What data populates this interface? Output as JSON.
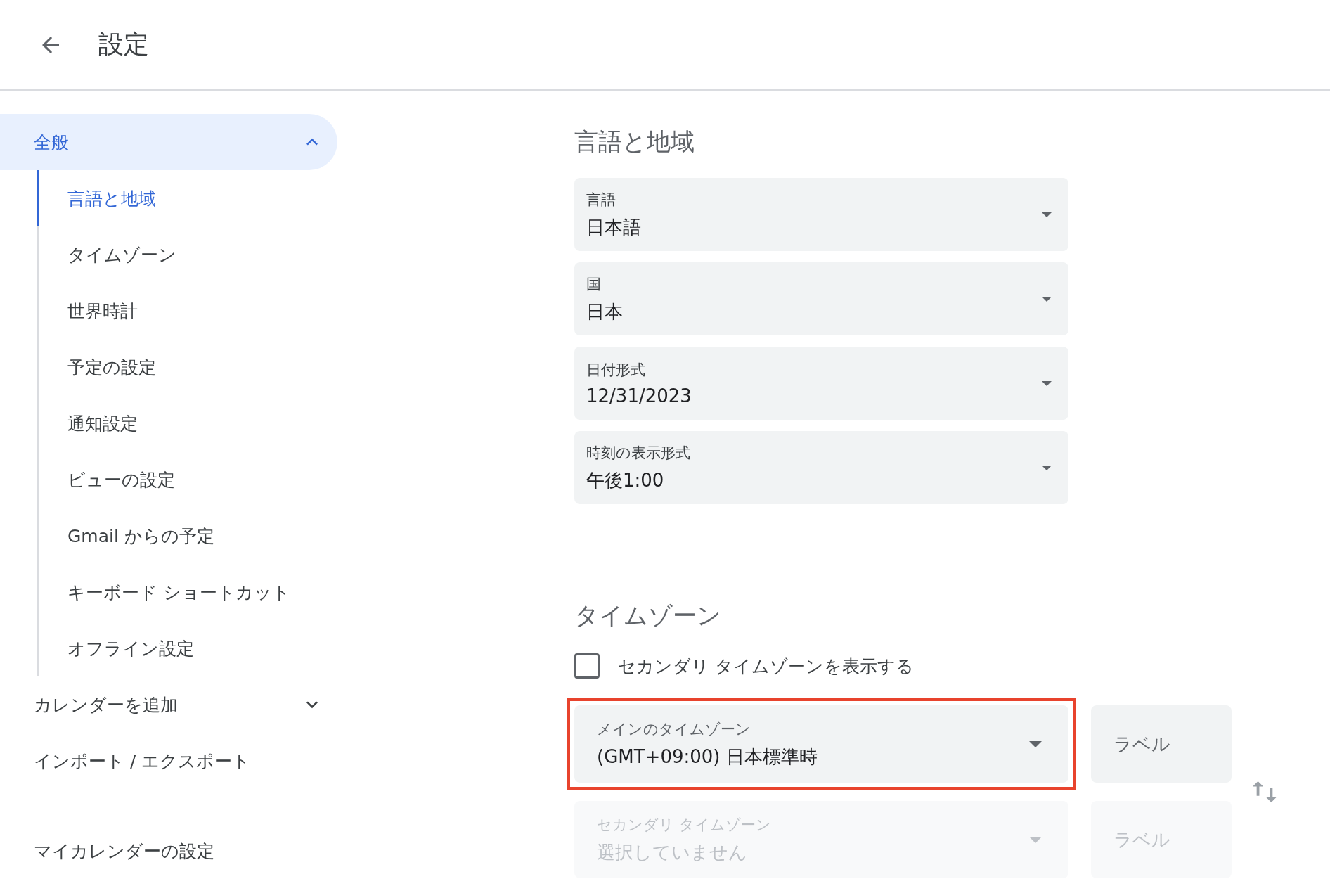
{
  "header": {
    "title": "設定"
  },
  "sidebar": {
    "groups": [
      {
        "label": "全般",
        "selected": true,
        "expanded": true,
        "children": [
          {
            "label": "言語と地域",
            "selected": true
          },
          {
            "label": "タイムゾーン",
            "selected": false
          },
          {
            "label": "世界時計",
            "selected": false
          },
          {
            "label": "予定の設定",
            "selected": false
          },
          {
            "label": "通知設定",
            "selected": false
          },
          {
            "label": "ビューの設定",
            "selected": false
          },
          {
            "label": "Gmail からの予定",
            "selected": false
          },
          {
            "label": "キーボード ショートカット",
            "selected": false
          },
          {
            "label": "オフライン設定",
            "selected": false
          }
        ]
      },
      {
        "label": "カレンダーを追加",
        "selected": false,
        "expanded": false
      },
      {
        "label": "インポート / エクスポート",
        "selected": false
      }
    ],
    "heading": "マイカレンダーの設定"
  },
  "language_region": {
    "title": "言語と地域",
    "fields": [
      {
        "label": "言語",
        "value": "日本語"
      },
      {
        "label": "国",
        "value": "日本"
      },
      {
        "label": "日付形式",
        "value": "12/31/2023"
      },
      {
        "label": "時刻の表示形式",
        "value": "午後1:00"
      }
    ]
  },
  "timezone": {
    "title": "タイムゾーン",
    "checkbox": {
      "label": "セカンダリ タイムゾーンを表示する",
      "checked": false
    },
    "rows": [
      {
        "label": "メインのタイムゾーン",
        "value": "(GMT+09:00) 日本標準時",
        "disabled": false,
        "highlighted": true,
        "button": "ラベル"
      },
      {
        "label": "セカンダリ タイムゾーン",
        "placeholder": "選択していません",
        "disabled": true,
        "highlighted": false,
        "button": "ラベル"
      }
    ]
  }
}
